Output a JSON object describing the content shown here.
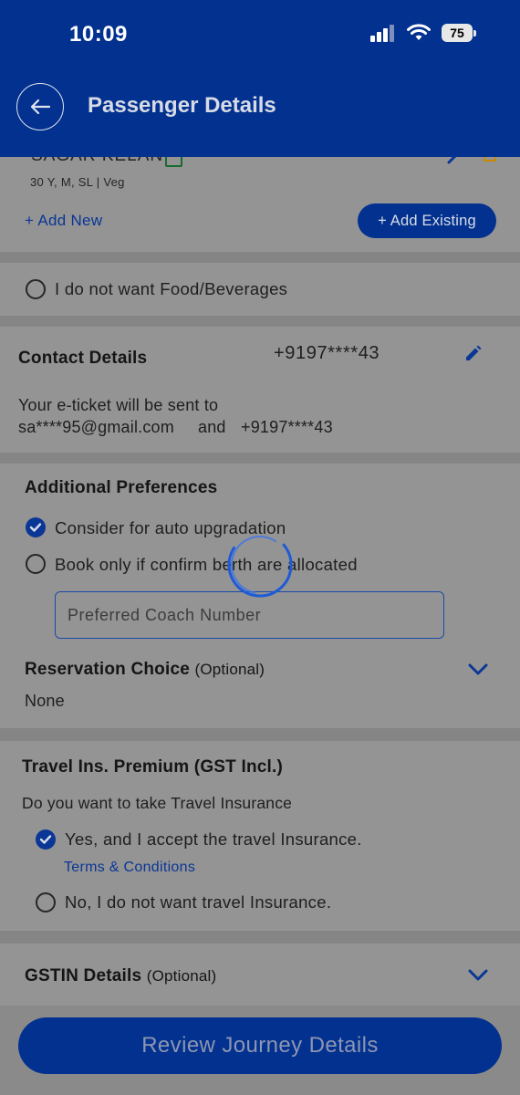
{
  "status_bar": {
    "time": "10:09",
    "battery": "75"
  },
  "header": {
    "title": "Passenger Details"
  },
  "passenger": {
    "name": "SAGAR KELAN",
    "info": "30 Y, M, SL | Veg",
    "add_new": "+ Add New",
    "add_existing": "+ Add Existing"
  },
  "food": {
    "label": "I do not want Food/Beverages"
  },
  "contact": {
    "title": "Contact Details",
    "phone": "+9197****43",
    "ticket_line1": "Your e-ticket will be sent to",
    "email": "sa****95@gmail.com",
    "and": "and",
    "phone2": "+9197****43"
  },
  "preferences": {
    "title": "Additional Preferences",
    "auto_upgrade": "Consider for auto upgradation",
    "confirm_berth": "Book only if confirm berth are allocated",
    "coach_placeholder": "Preferred Coach Number",
    "reservation_title": "Reservation Choice",
    "reservation_optional": "(Optional)",
    "reservation_value": "None"
  },
  "insurance": {
    "title": "Travel Ins. Premium (GST Incl.)",
    "question": "Do you want to take Travel Insurance",
    "yes": "Yes, and I accept the travel Insurance.",
    "terms": "Terms & Conditions",
    "no": "No, I do not want travel Insurance."
  },
  "gstin": {
    "title": "GSTIN Details",
    "optional": "(Optional)"
  },
  "footer": {
    "review_button": "Review Journey Details"
  },
  "colors": {
    "brand": "#03318f",
    "accent": "#0a3696",
    "overlay_bg": "#949494"
  }
}
